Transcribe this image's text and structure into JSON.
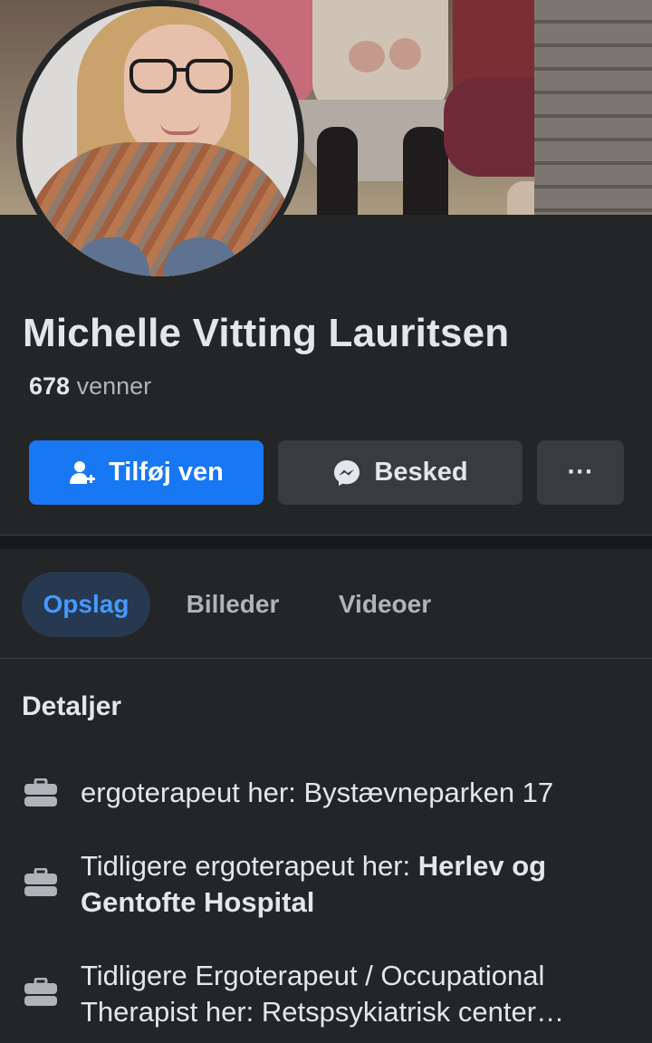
{
  "profile": {
    "name": "Michelle Vitting Lauritsen",
    "friends_count": "678",
    "friends_label": "venner"
  },
  "actions": {
    "add_friend": "Tilføj ven",
    "message": "Besked",
    "more": "···"
  },
  "tabs": [
    {
      "label": "Opslag",
      "active": true
    },
    {
      "label": "Billeder",
      "active": false
    },
    {
      "label": "Videoer",
      "active": false
    }
  ],
  "details": {
    "title": "Detaljer",
    "items": [
      {
        "prefix": "ergoterapeut her: Bystævneparken 17",
        "bold": ""
      },
      {
        "prefix": "Tidligere ergoterapeut her: ",
        "bold": "Herlev og Gentofte Hospital"
      },
      {
        "line1": "Tidligere Ergoterapeut / Occupational",
        "line2": "Therapist her: Retspsykiatrisk center…"
      }
    ]
  },
  "colors": {
    "background": "#242526",
    "primary": "#1877f2",
    "secondary_button": "#3a3b3c",
    "active_tab_bg": "#263951",
    "active_tab_text": "#4599ff"
  },
  "icons": {
    "add_friend": "person-plus-icon",
    "message": "messenger-icon",
    "detail": "briefcase-icon"
  }
}
